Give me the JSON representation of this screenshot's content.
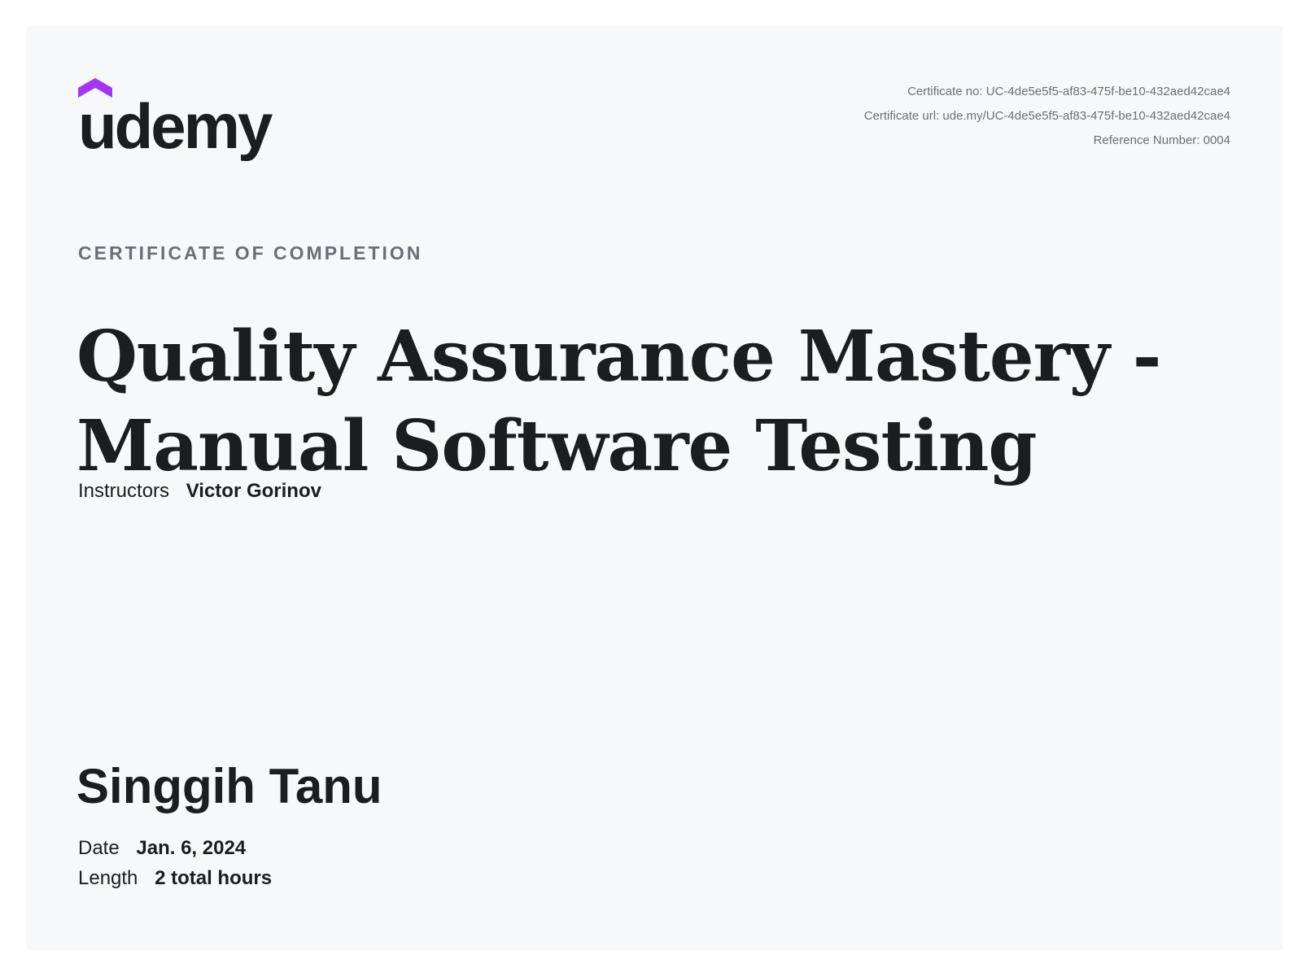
{
  "brand": {
    "name": "udemy",
    "accent_color": "#a435f0",
    "icon": "udemy-hat-icon"
  },
  "meta": {
    "certificate_no": "Certificate no: UC-4de5e5f5-af83-475f-be10-432aed42cae4",
    "certificate_url": "Certificate url: ude.my/UC-4de5e5f5-af83-475f-be10-432aed42cae4",
    "reference_number": "Reference Number: 0004"
  },
  "certificate": {
    "overline": "CERTIFICATE OF COMPLETION",
    "course_title": "Quality Assurance Mastery - Manual Software Testing",
    "instructors_label": "Instructors",
    "instructors_value": "Victor Gorinov",
    "recipient": "Singgih Tanu",
    "date_label": "Date",
    "date_value": "Jan. 6, 2024",
    "length_label": "Length",
    "length_value": "2 total hours"
  },
  "colors": {
    "background": "#f7f8fa",
    "text_primary": "#1c1d1f",
    "text_secondary": "#6a6f73"
  }
}
